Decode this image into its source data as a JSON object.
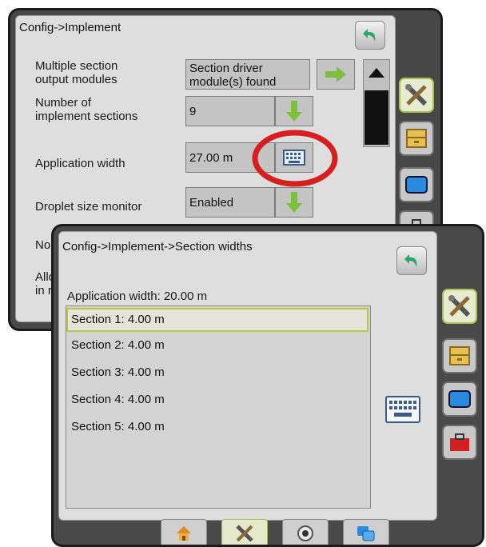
{
  "back_screen": {
    "title": "Config->Implement",
    "rows": [
      {
        "label": "Multiple section output modules",
        "label_lines": [
          "Multiple section",
          "output modules"
        ],
        "value_lines": [
          "Section driver",
          "module(s) found"
        ]
      },
      {
        "label_lines": [
          "Number of",
          "implement sections"
        ],
        "value": "9"
      },
      {
        "label": "Application width",
        "value": "27.00 m"
      },
      {
        "label": "Droplet size monitor",
        "value": "Enabled"
      },
      {
        "label_partial": "Noz"
      },
      {
        "label_partial_lines": [
          "Allo",
          "in r"
        ]
      }
    ]
  },
  "front_screen": {
    "title": "Config->Implement->Section widths",
    "application_width": "Application width: 20.00 m",
    "sections": [
      "Section 1: 4.00 m",
      "Section 2: 4.00 m",
      "Section 3: 4.00 m",
      "Section 4: 4.00 m",
      "Section 5: 4.00 m"
    ],
    "selected_index": 0
  },
  "colors": {
    "highlight_circle": "#d62020",
    "arrow_green": "#7ec03a",
    "accent_selection": "#b7c93c",
    "back_arrow": "#26a86a"
  },
  "icons": {
    "back": "back-arrow-icon",
    "keyboard": "keyboard-icon",
    "tools": "tools-icon",
    "drawer": "data-drawer-icon",
    "display": "display-icon",
    "toolbox": "toolbox-icon",
    "home": "home-icon",
    "camera": "camera-icon",
    "layers": "layers-icon"
  }
}
